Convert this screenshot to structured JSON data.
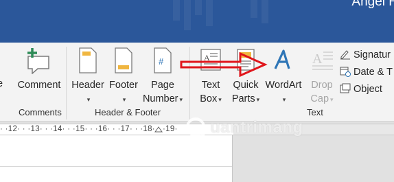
{
  "title_bar": {
    "user_name": "Angel H"
  },
  "ribbon": {
    "comments_group": {
      "comment_label": "Comment",
      "group_label": "Comments"
    },
    "header_footer_group": {
      "header_label": "Header",
      "footer_label": "Footer",
      "page_number_label_1": "Page",
      "page_number_label_2": "Number",
      "group_label": "Header & Footer"
    },
    "text_group": {
      "text_box_label_1": "Text",
      "text_box_label_2": "Box",
      "quick_parts_label_1": "Quick",
      "quick_parts_label_2": "Parts",
      "wordart_label": "WordArt",
      "drop_cap_label_1": "Drop",
      "drop_cap_label_2": "Cap",
      "signature_label": "Signatur",
      "date_time_label": "Date & T",
      "object_label": "Object",
      "group_label": "Text"
    },
    "edge_label": "e"
  },
  "ruler": {
    "text": "· ·12· · ·13· · ·14· · ·15· · ·16· · ·17· · ·18· · ·19·"
  },
  "watermark": {
    "text": "uantrimang"
  },
  "colors": {
    "title_bar": "#2b579a",
    "ribbon": "#f3f3f3",
    "arrow": "#e0151b",
    "wordart_icon": "#2e75b6"
  }
}
